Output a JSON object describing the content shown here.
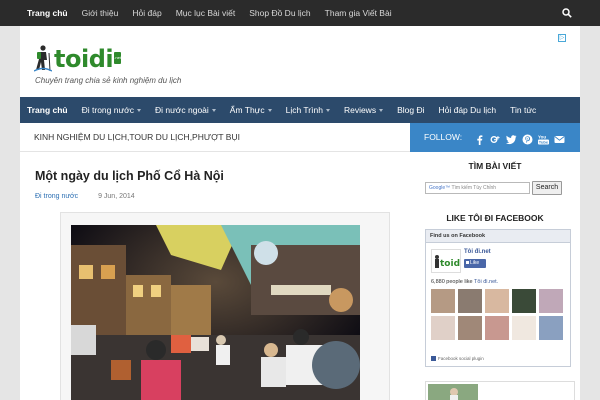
{
  "topbar": {
    "items": [
      "Trang chủ",
      "Giới thiệu",
      "Hỏi đáp",
      "Mục lục Bài viết",
      "Shop Đồ Du lịch",
      "Tham gia Viết Bài"
    ],
    "search_icon": "search-icon"
  },
  "header": {
    "logo_text": "toidi",
    "logo_badge": ".net",
    "tagline": "Chuyên trang chia sẻ kinh nghiệm du lịch"
  },
  "mainnav": {
    "items": [
      {
        "label": "Trang chủ",
        "dropdown": false
      },
      {
        "label": "Đi trong nước",
        "dropdown": true
      },
      {
        "label": "Đi nước ngoài",
        "dropdown": true
      },
      {
        "label": "Ẩm Thực",
        "dropdown": true
      },
      {
        "label": "Lịch Trình",
        "dropdown": true
      },
      {
        "label": "Reviews",
        "dropdown": true
      },
      {
        "label": "Blog Đi",
        "dropdown": false
      },
      {
        "label": "Hỏi đáp Du lịch",
        "dropdown": false
      },
      {
        "label": "Tin tức",
        "dropdown": false
      }
    ]
  },
  "content": {
    "breadcrumb": "KINH NGHIỆM DU LỊCH,TOUR DU LỊCH,PHƯỢT BỤI",
    "post_title": "Một ngày du lịch Phố Cổ Hà Nội",
    "post_category": "Đi trong nước",
    "post_date": "9 Jun, 2014"
  },
  "sidebar": {
    "follow_label": "FOLLOW:",
    "social_icons": [
      "facebook-icon",
      "google-plus-icon",
      "twitter-icon",
      "pinterest-icon",
      "youtube-icon",
      "email-icon"
    ],
    "search_title": "TÌM BÀI VIẾT",
    "search_placeholder": "Tìm kiếm Tùy Chỉnh",
    "search_button": "Search",
    "fb_title": "LIKE TÔI ĐI FACEBOOK",
    "fb_header": "Find us on Facebook",
    "fb_page_name": "Tôi đi.net",
    "fb_like": "Like",
    "fb_count_prefix": "6,880 people like",
    "fb_count_page": "Tôi đi.net.",
    "fb_footer": "Facebook social plugin"
  },
  "colors": {
    "topbar": "#2b2b2b",
    "mainnav": "#2c4a6b",
    "accent_blue": "#3a86c7",
    "brand_green": "#2f8a2c",
    "link": "#2c6fb3"
  }
}
